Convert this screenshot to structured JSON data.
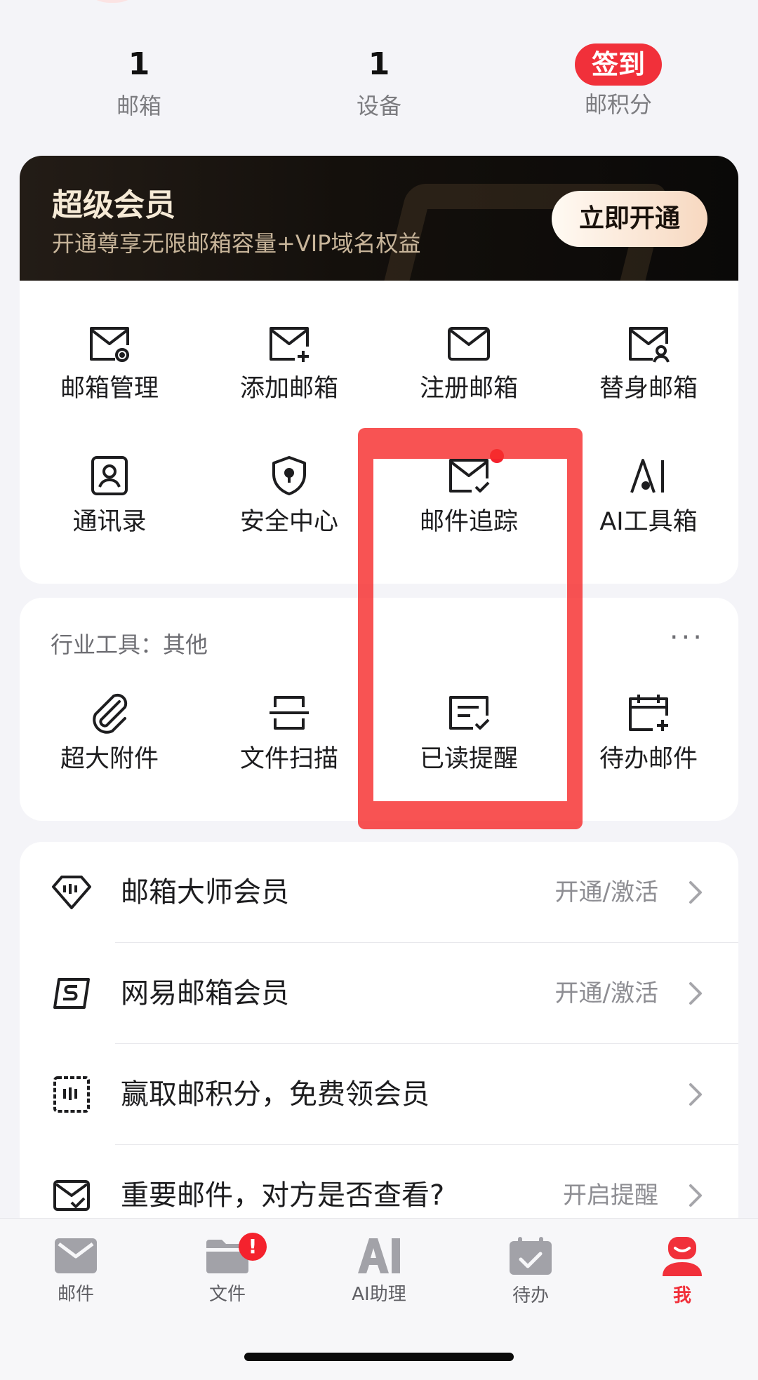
{
  "stats": [
    {
      "value": "1",
      "label": "邮箱"
    },
    {
      "value": "1",
      "label": "设备"
    },
    {
      "badge": "签到",
      "label": "邮积分"
    }
  ],
  "vip": {
    "title": "超级会员",
    "subtitle": "开通尊享无限邮箱容量+VIP域名权益",
    "button": "立即开通"
  },
  "mailbox_tools": [
    {
      "icon": "mail-settings-icon",
      "label": "邮箱管理"
    },
    {
      "icon": "mail-add-icon",
      "label": "添加邮箱"
    },
    {
      "icon": "mail-icon",
      "label": "注册邮箱"
    },
    {
      "icon": "mail-user-icon",
      "label": "替身邮箱"
    },
    {
      "icon": "contact-card-icon",
      "label": "通讯录"
    },
    {
      "icon": "shield-icon",
      "label": "安全中心"
    },
    {
      "icon": "mail-check-icon",
      "label": "邮件追踪",
      "has_dot": true
    },
    {
      "icon": "ai-icon",
      "label": "AI工具箱"
    }
  ],
  "industry": {
    "title": "行业工具：其他",
    "more": "···",
    "items": [
      {
        "icon": "paperclip-icon",
        "label": "超大附件"
      },
      {
        "icon": "scan-icon",
        "label": "文件扫描"
      },
      {
        "icon": "read-receipt-icon",
        "label": "已读提醒"
      },
      {
        "icon": "calendar-add-icon",
        "label": "待办邮件"
      }
    ]
  },
  "list": [
    {
      "icon": "diamond-icon",
      "title": "邮箱大师会员",
      "action": "开通/激活"
    },
    {
      "icon": "s-badge-icon",
      "title": "网易邮箱会员",
      "action": "开通/激活"
    },
    {
      "icon": "coupon-icon",
      "title": "赢取邮积分，免费领会员",
      "action": ""
    },
    {
      "icon": "mail-check-icon",
      "title": "重要邮件，对方是否查看?",
      "action": "开启提醒"
    }
  ],
  "tabs": [
    {
      "icon": "mail-tab-icon",
      "label": "邮件"
    },
    {
      "icon": "folder-tab-icon",
      "label": "文件",
      "badge": "!"
    },
    {
      "icon": "ai-tab-icon",
      "label": "AI助理"
    },
    {
      "icon": "todo-tab-icon",
      "label": "待办"
    },
    {
      "icon": "profile-tab-icon",
      "label": "我",
      "active": true
    }
  ],
  "colors": {
    "accent": "#f1303a",
    "annotation": "#f62d2d",
    "vip_dark": "#14100c",
    "vip_gold": "#f6ead6"
  }
}
